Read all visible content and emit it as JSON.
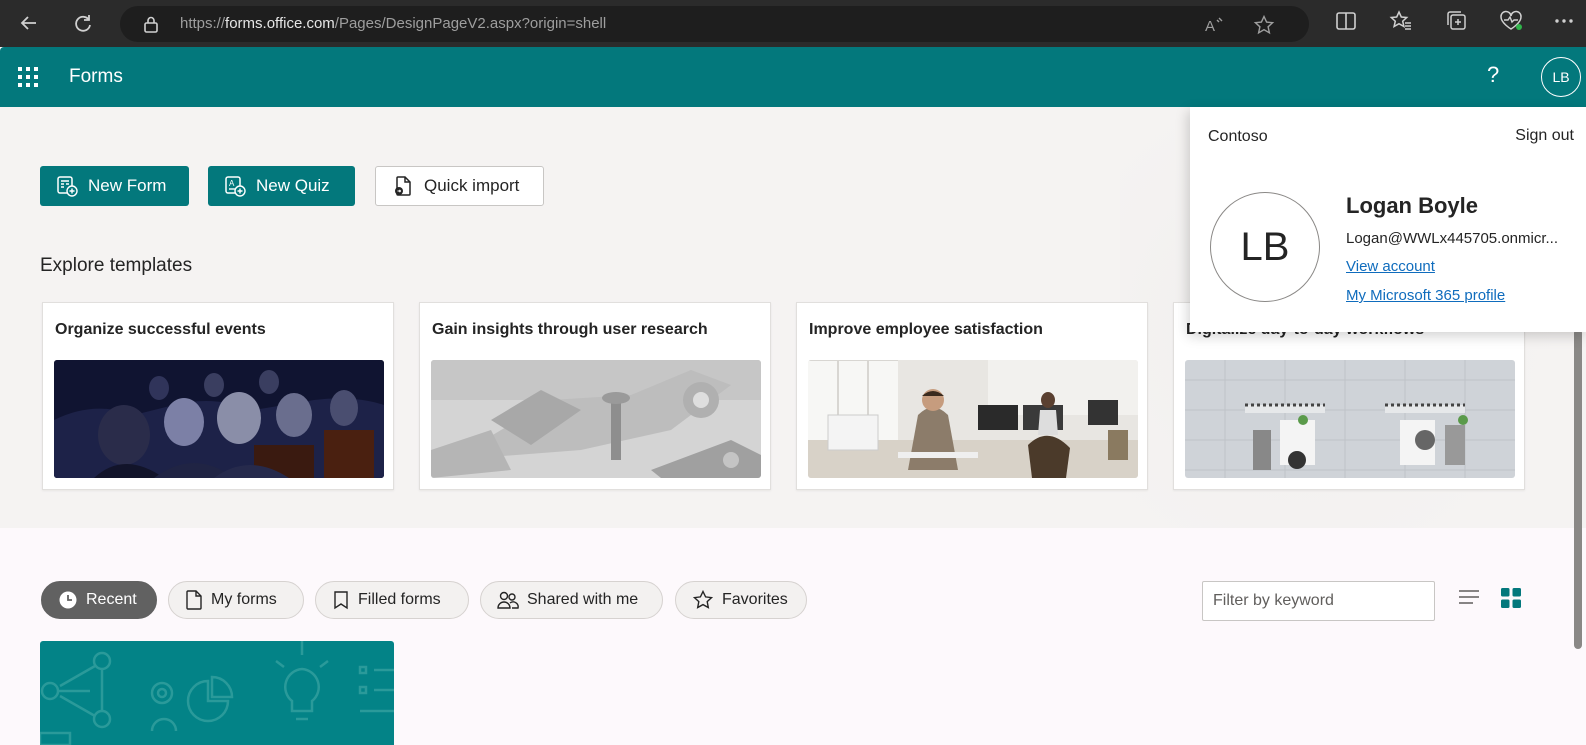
{
  "browser": {
    "url_prefix": "https://",
    "url_host": "forms.office.com",
    "url_path": "/Pages/DesignPageV2.aspx?origin=shell"
  },
  "app": {
    "name": "Forms",
    "help_label": "?",
    "avatar_initials": "LB"
  },
  "actions": {
    "new_form": "New Form",
    "new_quiz": "New Quiz",
    "quick_import": "Quick import"
  },
  "templates": {
    "heading": "Explore templates",
    "items": [
      {
        "title": "Organize successful events"
      },
      {
        "title": "Gain insights through user research"
      },
      {
        "title": "Improve employee satisfaction"
      },
      {
        "title": "Digitalize day-to-day workflows"
      }
    ]
  },
  "tabs": [
    {
      "label": "Recent",
      "active": true
    },
    {
      "label": "My forms"
    },
    {
      "label": "Filled forms"
    },
    {
      "label": "Shared with me"
    },
    {
      "label": "Favorites"
    }
  ],
  "filter": {
    "placeholder": "Filter by keyword"
  },
  "account": {
    "org": "Contoso",
    "sign_out": "Sign out",
    "initials": "LB",
    "name": "Logan Boyle",
    "email": "Logan@WWLx445705.onmicr...",
    "view_account": "View account",
    "profile_link": "My Microsoft 365 profile"
  },
  "colors": {
    "brand": "#03787c",
    "chrome": "#2b2b2b",
    "link": "#0f6cbd"
  }
}
